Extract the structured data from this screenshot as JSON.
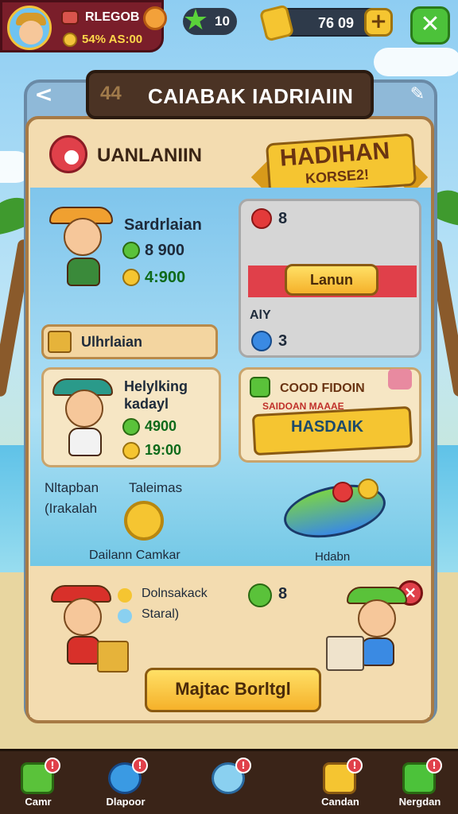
{
  "colors": {
    "accent_gold": "#f5c531",
    "accent_green": "#5ac23a",
    "accent_red": "#e0404a",
    "panel_tan": "#f3dcb0",
    "nav_bg": "#3a2418"
  },
  "hud": {
    "player_name": "RLEGOB",
    "player_sub": "54% AS:00",
    "gems_value": "10",
    "gold_value": "76 09",
    "plus_label": "+",
    "settings_icon": "crossed-tools-icon"
  },
  "panel": {
    "title": "CAIABAK IADRIAIIN",
    "title_emblem": "44",
    "back_label": "<",
    "section_heading": "UANLANIIN",
    "ribbon_line1": "HADIHAN",
    "ribbon_line2": "KORSE2!"
  },
  "card_top_left": {
    "name": "Sardrlaian",
    "stat1": "8 900",
    "stat2": "4:900"
  },
  "card_top_right": {
    "count_red": "8",
    "button_label": "Lanun",
    "label": "AlY",
    "count_blue": "3"
  },
  "tan_bar": {
    "label": "Ulhrlaian"
  },
  "card_mid_left": {
    "title_line1": "Helylking",
    "title_line2": "kadayl",
    "stat1": "4900",
    "stat2": "19:00"
  },
  "card_mid_right": {
    "line1": "COOD FIDOIN",
    "line2": "SAIDOAN MAAAE",
    "line3": "HASDAIK"
  },
  "beach_section": {
    "left_line1": "Nltapban",
    "left_line2": "(Irakalah",
    "mid_label": "Taleimas",
    "bottom_label": "Dailann Camkar",
    "right_label": "Hdabn"
  },
  "lower_card": {
    "line1": "Dolnsakack",
    "line2": "Staral)",
    "count": "8",
    "close_label": "×",
    "main_button": "Majtac Borltgl"
  },
  "nav": [
    {
      "label": "Camr",
      "badge": "!"
    },
    {
      "label": "Dlapoor",
      "badge": "!"
    },
    {
      "label": "",
      "badge": "!"
    },
    {
      "label": "Candan",
      "badge": "!"
    },
    {
      "label": "Nergdan",
      "badge": "!"
    }
  ]
}
